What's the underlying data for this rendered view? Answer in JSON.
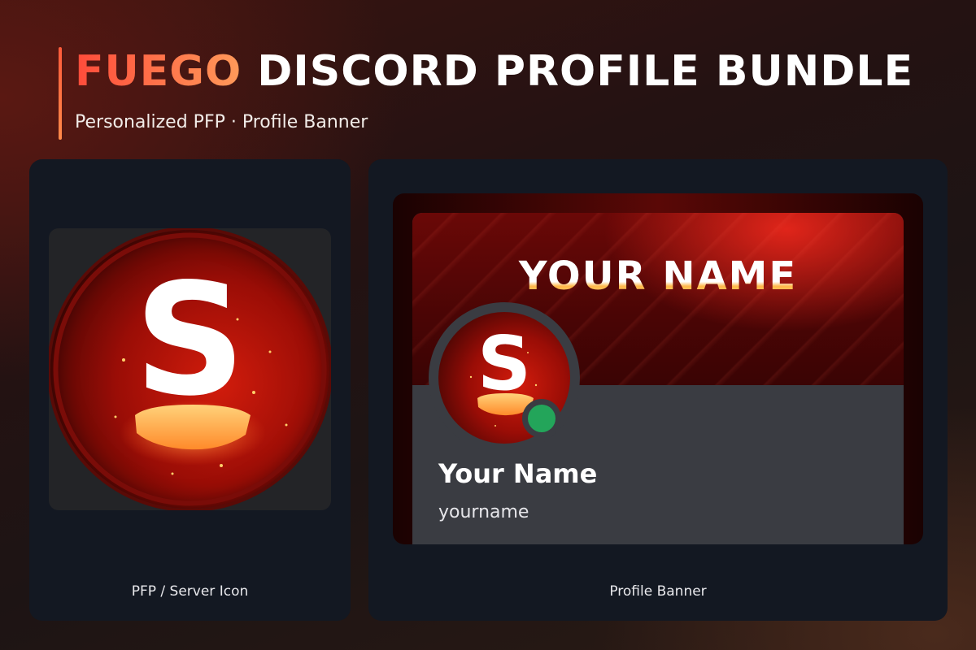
{
  "header": {
    "title_accent": "FUEGO",
    "title_rest": "DISCORD PROFILE BUNDLE",
    "subtitle": "Personalized PFP · Profile Banner"
  },
  "pfp_card": {
    "letter": "S",
    "caption": "PFP / Server Icon"
  },
  "banner_card": {
    "banner_text": "YOUR NAME",
    "avatar_letter": "S",
    "display_name": "Your Name",
    "username": "yourname",
    "caption": "Profile Banner"
  },
  "colors": {
    "accent_start": "#ff4b3a",
    "accent_end": "#ff9a5a",
    "card_bg": "#131822",
    "status_online": "#23a55a"
  }
}
